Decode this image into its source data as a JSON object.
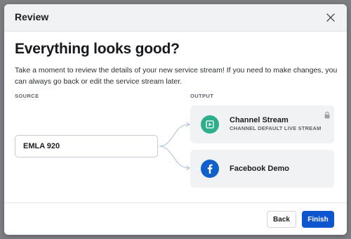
{
  "modal": {
    "title": "Review",
    "heading": "Everything looks good?",
    "description": "Take a moment to review the details of your new service stream! If you need to make changes, you can always go back or edit the service stream later."
  },
  "source": {
    "label": "SOURCE",
    "name": "EMLA 920"
  },
  "output": {
    "label": "OUTPUT",
    "items": [
      {
        "title": "Channel Stream",
        "subtitle": "CHANNEL DEFAULT LIVE STREAM",
        "icon": "play-icon",
        "icon_color": "#2fae8e",
        "locked": true
      },
      {
        "title": "Facebook Demo",
        "subtitle": "",
        "icon": "facebook-icon",
        "icon_color": "#1060c9",
        "locked": false
      }
    ]
  },
  "footer": {
    "back_label": "Back",
    "finish_label": "Finish"
  },
  "colors": {
    "primary": "#0f55d0",
    "connector": "#a9bfdc"
  }
}
